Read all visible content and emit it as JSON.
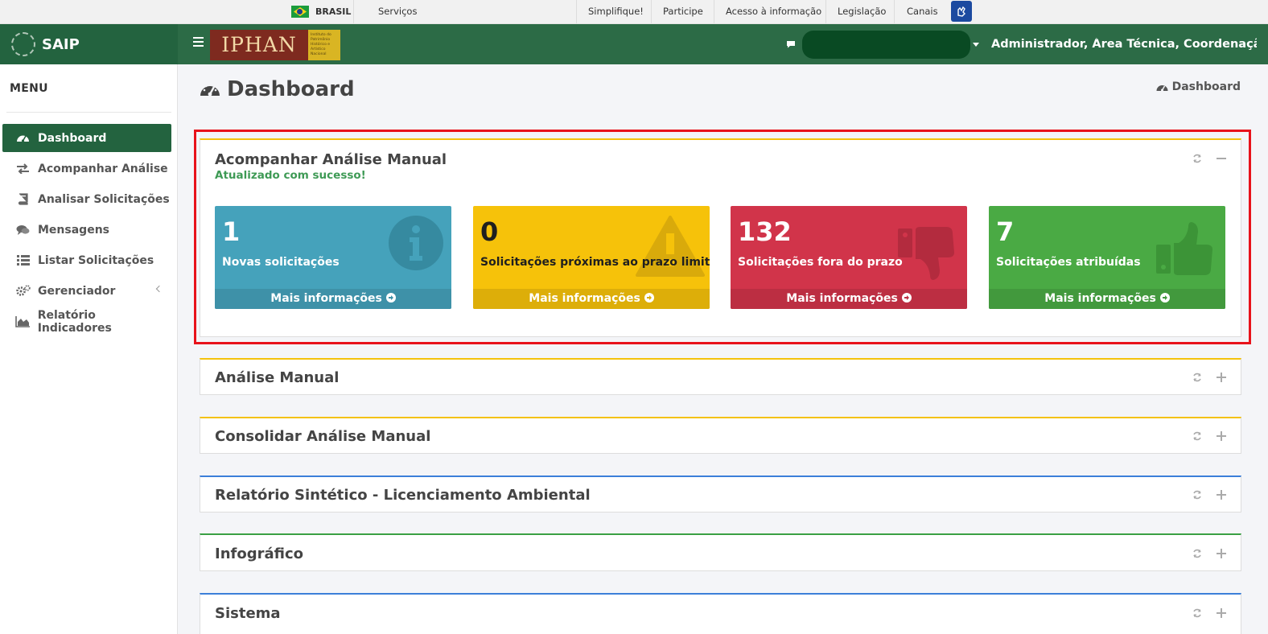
{
  "govbar": {
    "country": "BRASIL",
    "services": "Serviços",
    "links": [
      "Simplifique!",
      "Participe",
      "Acesso à informação",
      "Legislação",
      "Canais"
    ]
  },
  "header": {
    "app_name": "SAIP",
    "logo_text": "IPHAN",
    "logo_subtext": "Instituto do Patrimônio Histórico e Artístico Nacional",
    "user_roles": "Administrador, Área Técnica, Coordenação..."
  },
  "sidebar": {
    "menu_title": "MENU",
    "items": [
      {
        "label": "Dashboard",
        "icon": "dashboard-icon"
      },
      {
        "label": "Acompanhar Análise",
        "icon": "exchange-icon"
      },
      {
        "label": "Analisar Solicitações",
        "icon": "book-icon"
      },
      {
        "label": "Mensagens",
        "icon": "comments-icon"
      },
      {
        "label": "Listar Solicitações",
        "icon": "list-icon"
      },
      {
        "label": "Gerenciador",
        "icon": "gears-icon"
      },
      {
        "label": "Relatório Indicadores",
        "icon": "area-chart-icon"
      }
    ]
  },
  "page": {
    "title": "Dashboard",
    "breadcrumb": "Dashboard"
  },
  "panels": {
    "acompanhar": {
      "title": "Acompanhar Análise Manual",
      "status": "Atualizado com sucesso!",
      "stats": [
        {
          "value": "1",
          "label": "Novas solicitações",
          "more": "Mais informações",
          "color": "#45a2bb",
          "footer_color": "#3e91a8"
        },
        {
          "value": "0",
          "label": "Solicitações próximas ao prazo limite",
          "more": "Mais informações",
          "color": "#f6c20a",
          "footer_color": "#ddae09"
        },
        {
          "value": "132",
          "label": "Solicitações fora do prazo",
          "more": "Mais informações",
          "color": "#d1344a",
          "footer_color": "#bc2e42"
        },
        {
          "value": "7",
          "label": "Solicitações atribuídas",
          "more": "Mais informações",
          "color": "#4aaa44",
          "footer_color": "#42993d"
        }
      ]
    },
    "others": [
      {
        "title": "Análise Manual",
        "accent": "#f4c20d"
      },
      {
        "title": "Consolidar Análise Manual",
        "accent": "#f4c20d"
      },
      {
        "title": "Relatório Sintético - Licenciamento Ambiental",
        "accent": "#3c7fd9"
      },
      {
        "title": "Infográfico",
        "accent": "#3aa044"
      },
      {
        "title": "Sistema",
        "accent": "#3c7fd9"
      }
    ]
  }
}
